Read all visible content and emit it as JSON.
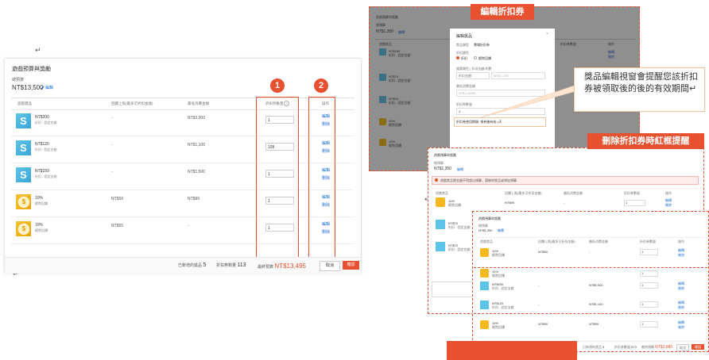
{
  "para_marks": [
    "↵",
    "↵",
    "↵",
    "↵"
  ],
  "main": {
    "title": "遊戲預算與獎勵",
    "budget_label": "總預算",
    "budget_value": "NT$13,500",
    "edit_label": "編輯",
    "headers": {
      "product": "遊戲獎品",
      "limit": "回饋上限(最多可折扣金額)",
      "min_spend": "最低消費金額",
      "quantity": "折扣券數量",
      "action": "操作"
    },
    "rows": [
      {
        "icon": "s",
        "name": "NT$200",
        "sub": "折扣 - 固定金額",
        "limit": "-",
        "min": "NT$3,000",
        "qty": "1"
      },
      {
        "icon": "s",
        "name": "NT$120",
        "sub": "折扣 - 固定金額",
        "limit": "-",
        "min": "NT$1,100",
        "qty": "109"
      },
      {
        "icon": "s",
        "name": "NT$150",
        "sub": "折扣 - 固定金額",
        "limit": "-",
        "min": "NT$1,500",
        "qty": "1"
      },
      {
        "icon": "c",
        "name": "10%",
        "sub": "蝦幣回饋",
        "limit": "NT$50",
        "min": "NT$99",
        "qty": "1"
      },
      {
        "icon": "c",
        "name": "10%",
        "sub": "蝦幣回饋",
        "limit": "NT$55",
        "min": "-",
        "qty": "1"
      }
    ],
    "edit_action": "編輯",
    "delete_action": "刪除",
    "badge1": "1",
    "badge2": "2",
    "footer": {
      "selected_label": "已新增的獎品",
      "selected_value": "5",
      "qty_label": "折扣券數量",
      "qty_value": "113",
      "budget_label": "最終預算",
      "budget_value": "NT$13,495",
      "cancel": "取消",
      "confirm": "確認"
    }
  },
  "shot1": {
    "tag": "編輯折扣券",
    "bg_title": "遊戲預算與獎勵",
    "bg_label": "總預算",
    "bg_budget": "NT$1,350",
    "bg_edit": "編輯",
    "bg_col_product": "遊戲獎品",
    "bg_col_qty": "折扣券數量",
    "bg_col_action": "操作",
    "bg_rows": [
      {
        "name": "NT$150",
        "sub": "折扣 - 固定金額"
      },
      {
        "name": "NT$70",
        "sub": "折扣 - 固定金額"
      },
      {
        "name": "NT$10",
        "sub": "折扣 - 固定金額"
      },
      {
        "name": "10%",
        "sub": "蝦幣回饋"
      },
      {
        "name": "10%",
        "sub": "蝦幣回饋"
      }
    ],
    "bg_actions": [
      "編輯",
      "刪除"
    ],
    "modal": {
      "title": "編輯獎品",
      "type_label": "獎品類型",
      "type_value": "賣場折扣券",
      "discount_type_label": "折扣類型",
      "opt_a": "折扣",
      "opt_b": "蝦幣回饋",
      "amount_label": "優惠類型 | 折扣金額/折數",
      "amount_select": "折扣金額",
      "amount_input": "NT$ 1-100",
      "min_label": "最低消費金額",
      "min_value": "NT$ 1-5000",
      "qty_label": "折扣券數量",
      "qty_value": "1",
      "validity": "折扣券使用期間: 領券後有效 n天",
      "cancel": "取消",
      "confirm": "確認"
    },
    "close_icon": "×"
  },
  "callout": {
    "text": "獎品編輯視窗會提醒您該折扣券被領取後的後的有效期間↵"
  },
  "shot2": {
    "tag": "刪除折扣券時紅框提醒",
    "title": "遊戲預算與獎勵",
    "label": "總預算",
    "budget": "NT$1,350",
    "edit": "編輯",
    "alert": "遊戲獎品總金額不得超出預算，請刪除獎品或增加預算",
    "headers": {
      "product": "遊戲獎品",
      "limit": "回饋上限(最多可折扣金額)",
      "min": "最低消費金額",
      "qty": "折扣券數量",
      "action": "操作"
    },
    "rows": [
      {
        "name": "10%",
        "sub": "蝦幣回饋",
        "limit": "NT$99",
        "min": "-",
        "qty": "1"
      },
      {
        "name": "NT$70",
        "sub": "折扣 - 固定金額",
        "limit": "",
        "min": "",
        "qty": ""
      },
      {
        "name": "NT$70",
        "sub": "折扣 - 固定金額",
        "limit": "",
        "min": "",
        "qty": ""
      }
    ],
    "actions": [
      "編輯",
      "刪除"
    ]
  },
  "shot3": {
    "title": "遊戲預算與獎勵",
    "label": "總預算",
    "budget": "NT$1,350",
    "edit": "編輯",
    "headers": {
      "product": "遊戲獎品",
      "limit": "回饋上限(最多可折扣金額)",
      "min": "最低消費金額",
      "qty": "折扣券數量",
      "action": "操作"
    },
    "rows": [
      {
        "icon": "c",
        "name": "10%",
        "sub": "蝦幣回饋",
        "limit": "NT$50",
        "min": "-",
        "qty": "1"
      },
      {
        "icon": "c",
        "name": "10%",
        "sub": "蝦幣回饋",
        "limit": "",
        "min": "",
        "qty": "1"
      },
      {
        "icon": "s",
        "name": "NT$200",
        "sub": "折扣 - 固定金額",
        "limit": "-",
        "min": "NT$3,000",
        "qty": "1"
      },
      {
        "icon": "s",
        "name": "NT$120",
        "sub": "折扣 - 固定金額",
        "limit": "-",
        "min": "NT$1,100",
        "qty": "1"
      },
      {
        "icon": "c",
        "name": "10%",
        "sub": "蝦幣回饋",
        "limit": "NT$50",
        "min": "NT$99",
        "qty": "1"
      }
    ],
    "actions": [
      "編輯",
      "刪除"
    ],
    "footer": {
      "selected_label": "已新增的獎品",
      "selected_value": "5",
      "qty_label": "折扣券數量",
      "qty_value": "573",
      "budget_label": "最終預算",
      "budget_value": "NT$3,680",
      "cancel": "取消",
      "confirm": "確認"
    }
  }
}
